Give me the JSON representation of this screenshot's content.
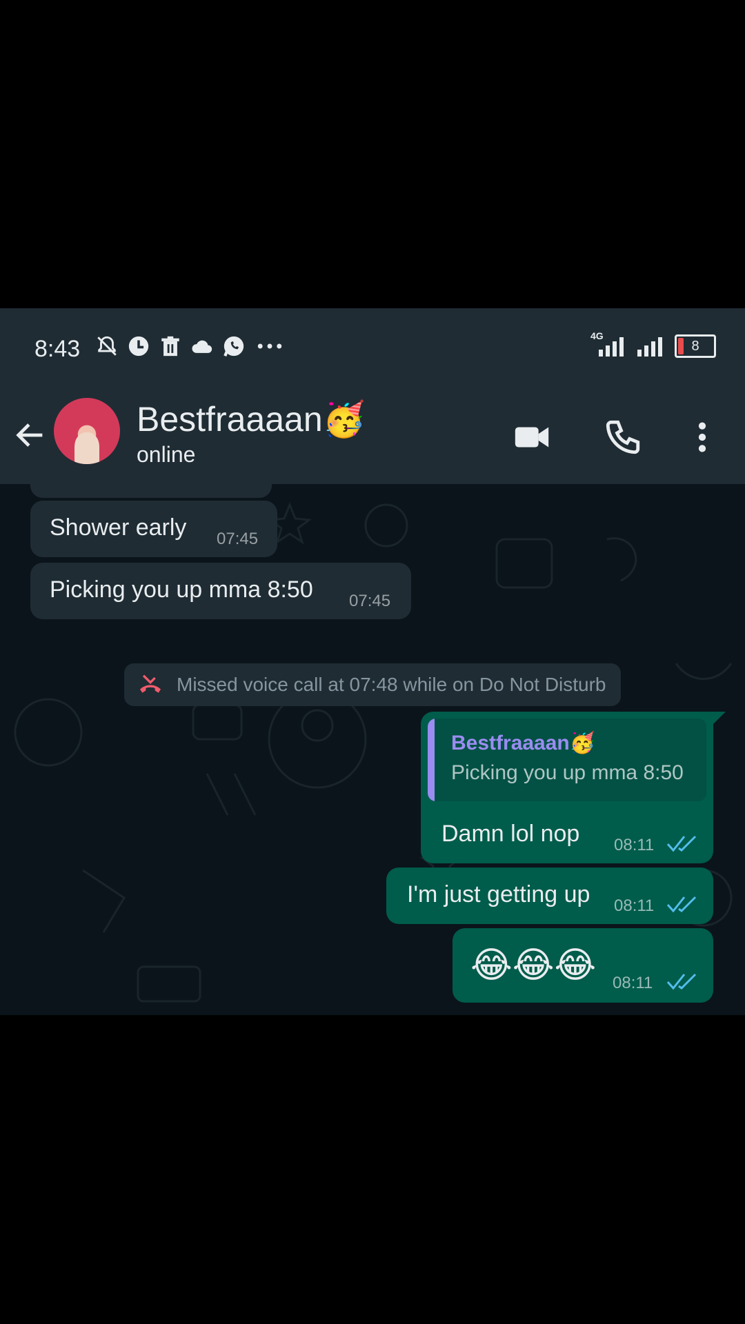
{
  "status_bar": {
    "time": "8:43",
    "network": "4G",
    "battery": "8",
    "icons": [
      "bell-off-icon",
      "clock-icon",
      "trash-icon",
      "cloud-icon",
      "whatsapp-icon",
      "more-dots-icon",
      "signal-icon",
      "battery-icon"
    ]
  },
  "header": {
    "contact_name": "Bestfraaaan🥳",
    "contact_status": "online",
    "icons": [
      "back-arrow-icon",
      "video-call-icon",
      "phone-icon",
      "menu-dots-icon"
    ]
  },
  "messages": [
    {
      "direction": "in",
      "text": "Shower early",
      "time": "07:45"
    },
    {
      "direction": "in",
      "text": "Picking you up mma 8:50",
      "time": "07:45"
    },
    {
      "direction": "system",
      "text": "Missed voice call at 07:48 while on Do Not Disturb"
    },
    {
      "direction": "out",
      "quote_name": "Bestfraaaan🥳",
      "quote_text": "Picking you up mma 8:50",
      "text": "Damn lol nop",
      "time": "08:11",
      "status": "read"
    },
    {
      "direction": "out",
      "text": "I'm just getting up",
      "time": "08:11",
      "status": "read"
    },
    {
      "direction": "out",
      "text": "😂😂😂",
      "time": "08:11",
      "status": "read"
    }
  ],
  "colors": {
    "header_bg": "#1f2c34",
    "chat_bg": "#0b141a",
    "incoming_bubble": "#1f2c34",
    "outgoing_bubble": "#005c4b",
    "read_tick": "#53bdeb",
    "quote_accent": "#9b8cf1",
    "missed_call": "#f15c6d"
  }
}
